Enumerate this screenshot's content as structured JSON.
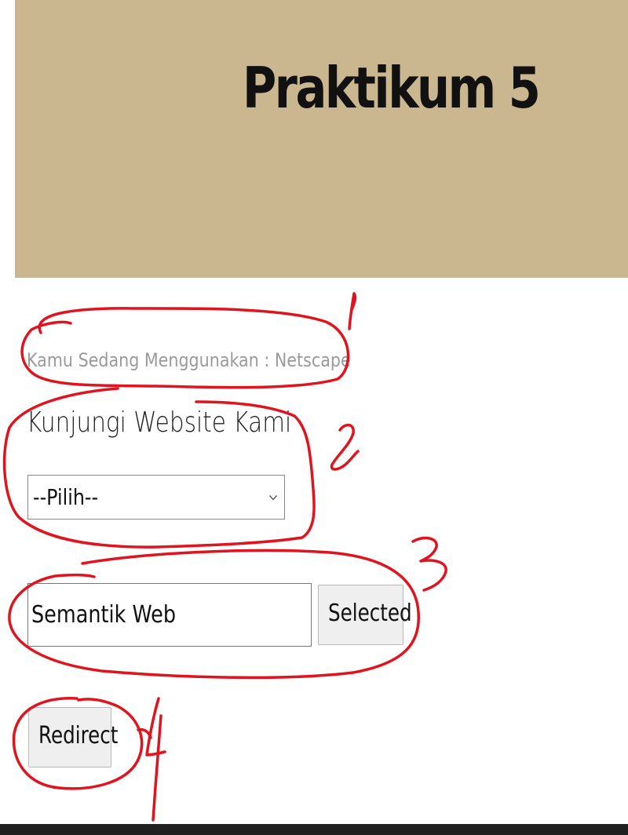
{
  "header": {
    "title": "Praktikum 5",
    "background_color": "#cbb78f"
  },
  "browser_info": {
    "text": "Kamu Sedang Menggunakan : Netscape"
  },
  "website_section": {
    "heading": "Kunjungi Website Kami",
    "select": {
      "selected_option": "--Pilih--",
      "icon": "chevron-down-icon"
    }
  },
  "selection": {
    "input_value": "Semantik Web",
    "selected_button_label": "Selected"
  },
  "redirect": {
    "button_label": "Redirect"
  },
  "annotations": {
    "color": "#e0141e",
    "marks": [
      "1",
      "2",
      "3",
      "4"
    ]
  }
}
